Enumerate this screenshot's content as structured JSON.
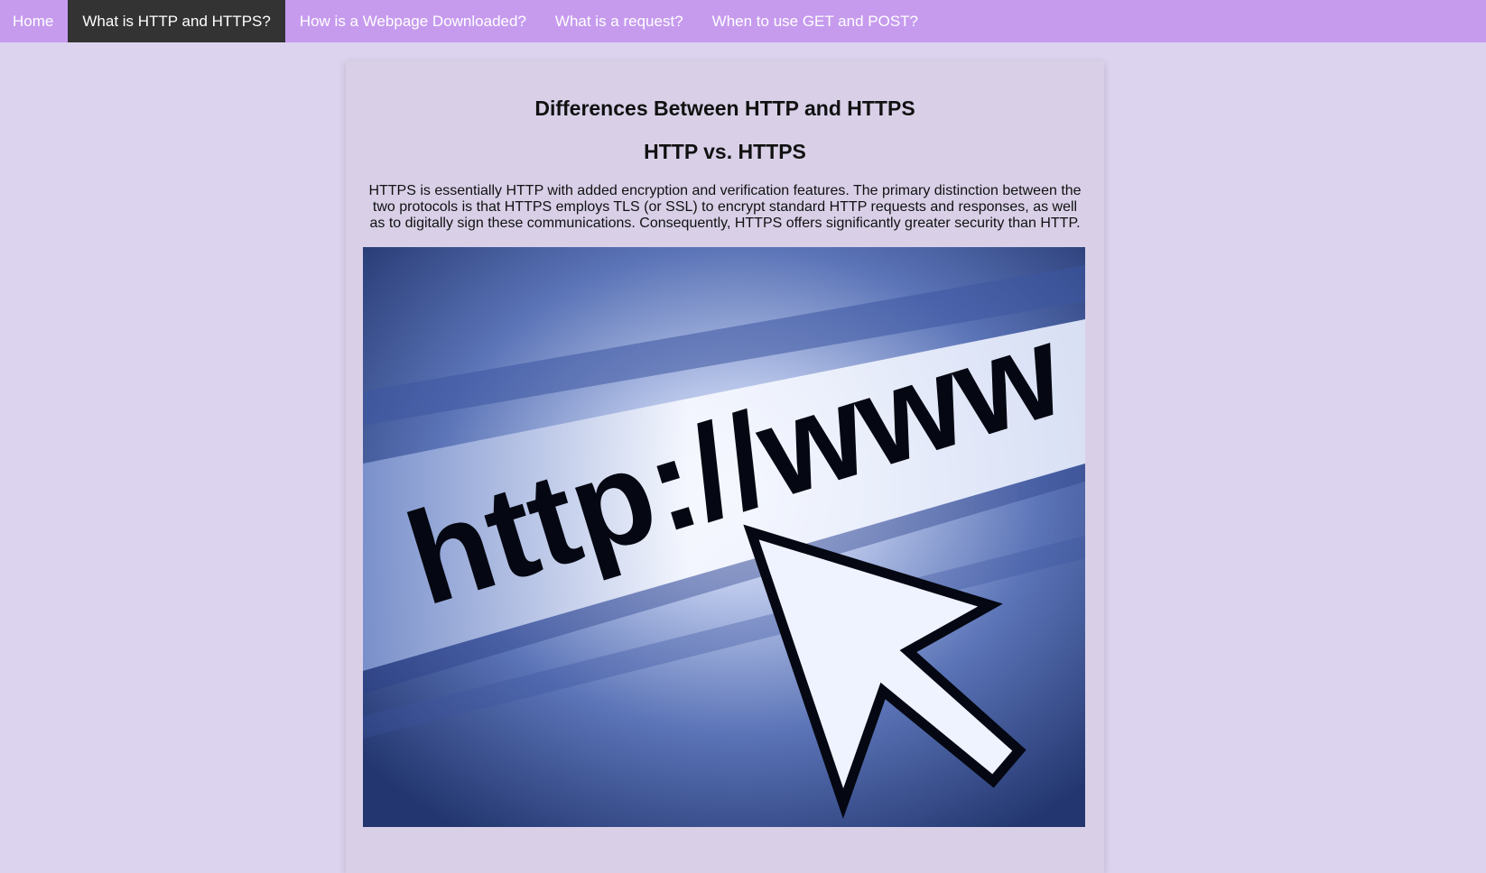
{
  "nav": {
    "items": [
      {
        "label": "Home"
      },
      {
        "label": "What is HTTP and HTTPS?"
      },
      {
        "label": "How is a Webpage Downloaded?"
      },
      {
        "label": "What is a request?"
      },
      {
        "label": "When to use GET and POST?"
      }
    ],
    "active_index": 1
  },
  "main": {
    "title": "Differences Between HTTP and HTTPS",
    "subtitle": "HTTP vs. HTTPS",
    "paragraph": "HTTPS is essentially HTTP with added encryption and verification features. The primary distinction between the two protocols is that HTTPS employs TLS (or SSL) to encrypt standard HTTP requests and responses, as well as to digitally sign these communications. Consequently, HTTPS offers significantly greater security than HTTP.",
    "image": {
      "text": "http://www"
    }
  },
  "colors": {
    "page_background": "#dcd3ee",
    "nav_background": "#c69bee",
    "nav_active": "#333333",
    "card_background": "#d9d0e8",
    "image_blue": "#2f4a8f"
  }
}
